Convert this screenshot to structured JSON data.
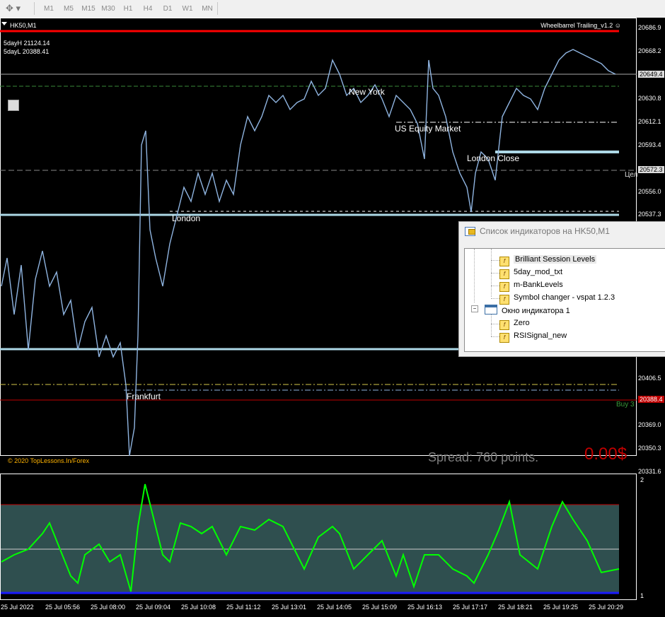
{
  "toolbar": {
    "timeframes": [
      "M1",
      "M5",
      "M15",
      "M30",
      "H1",
      "H4",
      "D1",
      "W1",
      "MN"
    ]
  },
  "chart": {
    "symbol": "HK50,M1",
    "ea_name": "Wheelbarrel Trailing_v1.2",
    "ea_face": "☺",
    "day_high": "5dayH 21124.14",
    "day_low": "5dayL 20388.41",
    "sessions": {
      "london": "London",
      "new_york": "New York",
      "us_equity": "US Equity Market",
      "london_close": "London Close",
      "frankfurt": "Frankfurt"
    },
    "copyright": "© 2020 TopLessons.In/Forex",
    "spread": "Spread: 760 points.",
    "profit": "0.00$",
    "buy_label": "Buy 3",
    "cel_label": "Цел",
    "price_scale": [
      "20686.9",
      "20668.2",
      "20630.8",
      "20612.1",
      "20593.4",
      "20556.0",
      "20537.3",
      "20406.5",
      "20369.0",
      "20350.3",
      "20331.6"
    ],
    "current_price": "20649.4",
    "marker_price": "20572.3",
    "buy_price": "20388.4",
    "subwindow_scale_top": "2",
    "subwindow_scale_bottom": "1",
    "time_axis": [
      "25 Jul 2022",
      "25 Jul 05:56",
      "25 Jul 08:00",
      "25 Jul 09:04",
      "25 Jul 10:08",
      "25 Jul 11:12",
      "25 Jul 13:01",
      "25 Jul 14:05",
      "25 Jul 15:09",
      "25 Jul 16:13",
      "25 Jul 17:17",
      "25 Jul 18:21",
      "25 Jul 19:25",
      "25 Jul 20:29"
    ],
    "colors": {
      "background": "#000000",
      "price_line": "#8fb4e0",
      "session_line": "#add8e6",
      "red_line": "#ff0000",
      "sub_fill": "#2f4f4f",
      "oscillator_up": "#00ff00",
      "oscillator_down": "#ff0000"
    }
  },
  "dialog": {
    "title": "Список индикаторов на HK50,M1",
    "items": [
      {
        "label": "Brilliant Session Levels",
        "selected": true
      },
      {
        "label": "5day_mod_txt"
      },
      {
        "label": "m-BankLevels"
      },
      {
        "label": "Symbol changer - vspat 1.2.3"
      }
    ],
    "window_label": "Окно индикатора 1",
    "window_items": [
      {
        "label": "Zero"
      },
      {
        "label": "RSISignal_new"
      }
    ]
  }
}
